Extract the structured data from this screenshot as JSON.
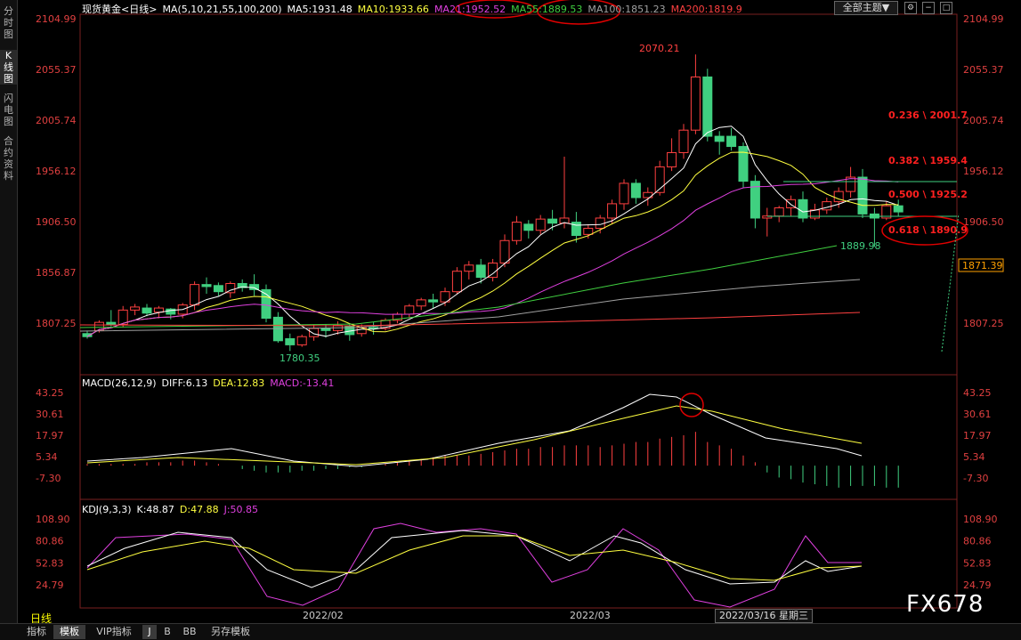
{
  "left_tabs": [
    {
      "label": "分时图",
      "active": false
    },
    {
      "label": "K线图",
      "active": true
    },
    {
      "label": "闪电图",
      "active": false
    },
    {
      "label": "合约资料",
      "active": false
    }
  ],
  "header": {
    "instrument": "现货黄金",
    "period_tag": "<日线>",
    "ma_spec": "MA(5,10,21,55,100,200)",
    "ma5": "MA5:1931.48",
    "ma10": "MA10:1933.66",
    "ma21": "MA21:1952.52",
    "ma55": "MA55:1889.53",
    "ma100": "MA100:1851.23",
    "ma200": "MA200:1819.9",
    "theme_button": "全部主题▼"
  },
  "price_axis": {
    "left_labels": [
      "2104.99",
      "2055.37",
      "2005.74",
      "1956.12",
      "1906.50",
      "1856.87",
      "1807.25"
    ],
    "right_labels": [
      "2104.99",
      "2055.37",
      "2005.74",
      "1956.12",
      "1906.50",
      "1807.25"
    ],
    "current_price": "1871.39",
    "high_label": "2070.21",
    "low_label": "1780.35",
    "recent_low_label": "1889.98"
  },
  "fibonacci": [
    {
      "label": "0.236 \\ 2001.7",
      "value": 2001.7
    },
    {
      "label": "0.382 \\ 1959.4",
      "value": 1959.4
    },
    {
      "label": "0.500 \\ 1925.2",
      "value": 1925.2
    },
    {
      "label": "0.618 \\ 1890.9",
      "value": 1890.9
    }
  ],
  "macd": {
    "title": "MACD(26,12,9)",
    "diff": "DIFF:6.13",
    "dea": "DEA:12.83",
    "macd": "MACD:-13.41",
    "axis_labels": [
      "43.25",
      "30.61",
      "17.97",
      "5.34",
      "-7.30"
    ]
  },
  "kdj": {
    "title": "KDJ(9,3,3)",
    "k": "K:48.87",
    "d": "D:47.88",
    "j": "J:50.85",
    "axis_labels": [
      "108.90",
      "80.86",
      "52.83",
      "24.79"
    ]
  },
  "x_axis": {
    "period": "日线",
    "labels": [
      "2022/02",
      "2022/03"
    ],
    "cursor_date": "2022/03/16 星期三"
  },
  "bottom_tabs": [
    {
      "label": "指标",
      "selected": false
    },
    {
      "label": "模板",
      "selected": true
    },
    {
      "label": "VIP指标",
      "selected": false
    },
    {
      "label": "J",
      "selected": true
    },
    {
      "label": "B",
      "selected": false
    },
    {
      "label": "BB",
      "selected": false
    },
    {
      "label": "另存模板",
      "selected": false
    }
  ],
  "watermark": "FX678",
  "colors": {
    "up": "#ff4040",
    "down": "#40d080",
    "ma5": "#ffffff",
    "ma10": "#ffff40",
    "ma21": "#e040e0",
    "ma55": "#40d040",
    "ma100": "#a0a0a0",
    "ma200": "#ff4040",
    "annotation": "#e00000"
  },
  "chart_data": {
    "type": "candlestick",
    "candles": [
      [
        1797,
        1800,
        1794,
        1792
      ],
      [
        1800,
        1810,
        1808,
        1798
      ],
      [
        1808,
        1820,
        1806,
        1804
      ],
      [
        1806,
        1824,
        1820,
        1803
      ],
      [
        1820,
        1826,
        1823,
        1815
      ],
      [
        1822,
        1826,
        1817,
        1814
      ],
      [
        1818,
        1824,
        1822,
        1812
      ],
      [
        1821,
        1822,
        1816,
        1811
      ],
      [
        1816,
        1827,
        1825,
        1812
      ],
      [
        1825,
        1848,
        1845,
        1820
      ],
      [
        1845,
        1852,
        1843,
        1836
      ],
      [
        1844,
        1847,
        1838,
        1834
      ],
      [
        1837,
        1848,
        1846,
        1832
      ],
      [
        1846,
        1850,
        1842,
        1838
      ],
      [
        1845,
        1855,
        1840,
        1834
      ],
      [
        1840,
        1845,
        1812,
        1808
      ],
      [
        1813,
        1818,
        1790,
        1788
      ],
      [
        1792,
        1797,
        1786,
        1780
      ],
      [
        1786,
        1796,
        1794,
        1784
      ],
      [
        1794,
        1806,
        1802,
        1790
      ],
      [
        1802,
        1806,
        1800,
        1793
      ],
      [
        1800,
        1809,
        1805,
        1796
      ],
      [
        1804,
        1807,
        1796,
        1790
      ],
      [
        1797,
        1806,
        1803,
        1794
      ],
      [
        1803,
        1808,
        1802,
        1796
      ],
      [
        1802,
        1812,
        1810,
        1800
      ],
      [
        1810,
        1818,
        1816,
        1807
      ],
      [
        1816,
        1826,
        1824,
        1812
      ],
      [
        1824,
        1832,
        1830,
        1820
      ],
      [
        1830,
        1836,
        1828,
        1822
      ],
      [
        1828,
        1842,
        1838,
        1824
      ],
      [
        1838,
        1862,
        1858,
        1836
      ],
      [
        1858,
        1868,
        1864,
        1850
      ],
      [
        1864,
        1870,
        1852,
        1846
      ],
      [
        1852,
        1870,
        1866,
        1848
      ],
      [
        1866,
        1894,
        1888,
        1862
      ],
      [
        1888,
        1912,
        1906,
        1884
      ],
      [
        1904,
        1908,
        1898,
        1890
      ],
      [
        1898,
        1913,
        1909,
        1894
      ],
      [
        1909,
        1918,
        1905,
        1898
      ],
      [
        1905,
        1970,
        1910,
        1900
      ],
      [
        1906,
        1916,
        1893,
        1886
      ],
      [
        1894,
        1904,
        1900,
        1890
      ],
      [
        1900,
        1913,
        1910,
        1895
      ],
      [
        1910,
        1928,
        1924,
        1904
      ],
      [
        1924,
        1948,
        1944,
        1918
      ],
      [
        1944,
        1948,
        1930,
        1924
      ],
      [
        1930,
        1940,
        1935,
        1922
      ],
      [
        1935,
        1966,
        1960,
        1932
      ],
      [
        1960,
        1988,
        1974,
        1956
      ],
      [
        1974,
        2002,
        1996,
        1968
      ],
      [
        1996,
        2070,
        2048,
        1992
      ],
      [
        2048,
        2056,
        1990,
        1985
      ],
      [
        1990,
        1995,
        1985,
        1972
      ],
      [
        1990,
        1998,
        1980,
        1976
      ],
      [
        1980,
        1984,
        1946,
        1940
      ],
      [
        1946,
        1952,
        1910,
        1900
      ],
      [
        1910,
        1920,
        1912,
        1892
      ],
      [
        1912,
        1922,
        1920,
        1906
      ],
      [
        1920,
        1932,
        1928,
        1912
      ],
      [
        1928,
        1936,
        1910,
        1906
      ],
      [
        1910,
        1924,
        1918,
        1908
      ],
      [
        1918,
        1930,
        1926,
        1914
      ],
      [
        1926,
        1940,
        1936,
        1920
      ],
      [
        1936,
        1960,
        1950,
        1930
      ],
      [
        1950,
        1958,
        1914,
        1910
      ],
      [
        1914,
        1920,
        1910,
        1882
      ],
      [
        1910,
        1926,
        1922,
        1908
      ],
      [
        1922,
        1928,
        1916,
        1912
      ]
    ]
  }
}
